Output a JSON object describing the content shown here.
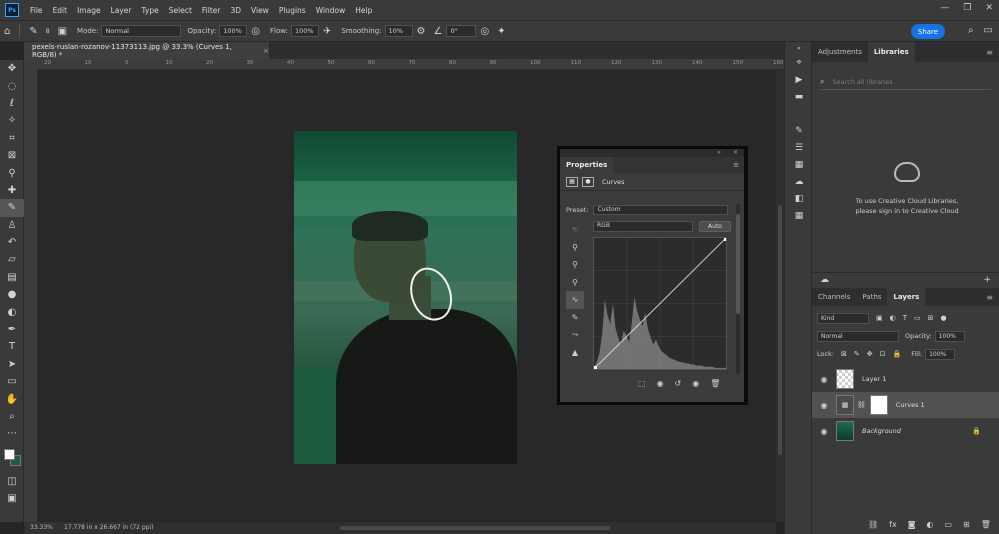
{
  "app": {
    "logo": "Ps",
    "menu": [
      "File",
      "Edit",
      "Image",
      "Layer",
      "Type",
      "Select",
      "Filter",
      "3D",
      "View",
      "Plugins",
      "Window",
      "Help"
    ],
    "window_controls": [
      "—",
      "❐",
      "✕"
    ]
  },
  "options": {
    "mode_label": "Mode:",
    "mode_value": "Normal",
    "opacity_label": "Opacity:",
    "opacity_value": "100%",
    "flow_label": "Flow:",
    "flow_value": "100%",
    "smoothing_label": "Smoothing:",
    "smoothing_value": "10%",
    "angle_value": "0°",
    "brush_size": "8",
    "share_label": "Share"
  },
  "document": {
    "tab_title": "pexels-ruslan-rozanov-11373113.jpg @ 33.3% (Curves 1, RGB/8) *",
    "zoom": "33.33%",
    "size": "17.778 in x 26.667 in (72 ppi)",
    "ruler_labels": [
      "20",
      "10",
      "0",
      "10",
      "20",
      "30",
      "40",
      "50",
      "60",
      "70",
      "80",
      "90",
      "100",
      "110",
      "120",
      "130",
      "140",
      "150",
      "160"
    ]
  },
  "properties": {
    "tab": "Properties",
    "title": "Curves",
    "preset_label": "Preset:",
    "preset_value": "Custom",
    "channel_value": "RGB",
    "auto_label": "Auto"
  },
  "right_panel": {
    "tabs": [
      "Adjustments",
      "Libraries"
    ],
    "search_placeholder": "Search all libraries",
    "message_line1": "To use Creative Cloud Libraries,",
    "message_line2": "please sign in to Creative Cloud"
  },
  "layers_panel": {
    "tabs": [
      "Channels",
      "Paths",
      "Layers"
    ],
    "filter_value": "Kind",
    "blend_mode": "Normal",
    "opacity_label": "Opacity:",
    "opacity_value": "100%",
    "lock_label": "Lock:",
    "fill_label": "Fill:",
    "fill_value": "100%",
    "layers": [
      {
        "name": "Layer 1"
      },
      {
        "name": "Curves 1"
      },
      {
        "name": "Background"
      }
    ]
  },
  "chart_data": {
    "type": "line",
    "title": "",
    "xlabel": "",
    "ylabel": "",
    "xlim": [
      0,
      255
    ],
    "ylim": [
      0,
      255
    ],
    "series": [
      {
        "x": [
          0,
          255
        ],
        "values": [
          0,
          255
        ]
      }
    ],
    "histogram": [
      2,
      6,
      14,
      30,
      62,
      48,
      40,
      58,
      36,
      28,
      22,
      34,
      30,
      24,
      40,
      64,
      52,
      44,
      38,
      50,
      36,
      28,
      22,
      26,
      20,
      16,
      14,
      12,
      10,
      9,
      8,
      7,
      6,
      6,
      5,
      5,
      4,
      4,
      3,
      3,
      3,
      2,
      2,
      2,
      2,
      1,
      1,
      1,
      1,
      1
    ]
  },
  "colors": {
    "accent": "#1473e6",
    "foreground": "#ffffff",
    "background_swatch": "#1e5a44",
    "panel": "#3a3a3a",
    "canvas": "#282828"
  },
  "icons": {
    "tools": [
      "move-icon",
      "marquee-icon",
      "lasso-icon",
      "magic-wand-icon",
      "crop-icon",
      "frame-icon",
      "eyedropper-icon",
      "healing-icon",
      "brush-icon",
      "stamp-icon",
      "history-brush-icon",
      "eraser-icon",
      "gradient-icon",
      "blur-icon",
      "dodge-icon",
      "pen-icon",
      "type-icon",
      "path-select-icon",
      "rectangle-icon",
      "hand-icon",
      "zoom-icon",
      "more-icon"
    ],
    "strip": [
      "history-icon",
      "play-icon",
      "comments-icon",
      "brush-settings-icon",
      "sliders-icon",
      "grid-icon",
      "libraries-icon",
      "layers-icon",
      "swatches-icon"
    ]
  }
}
